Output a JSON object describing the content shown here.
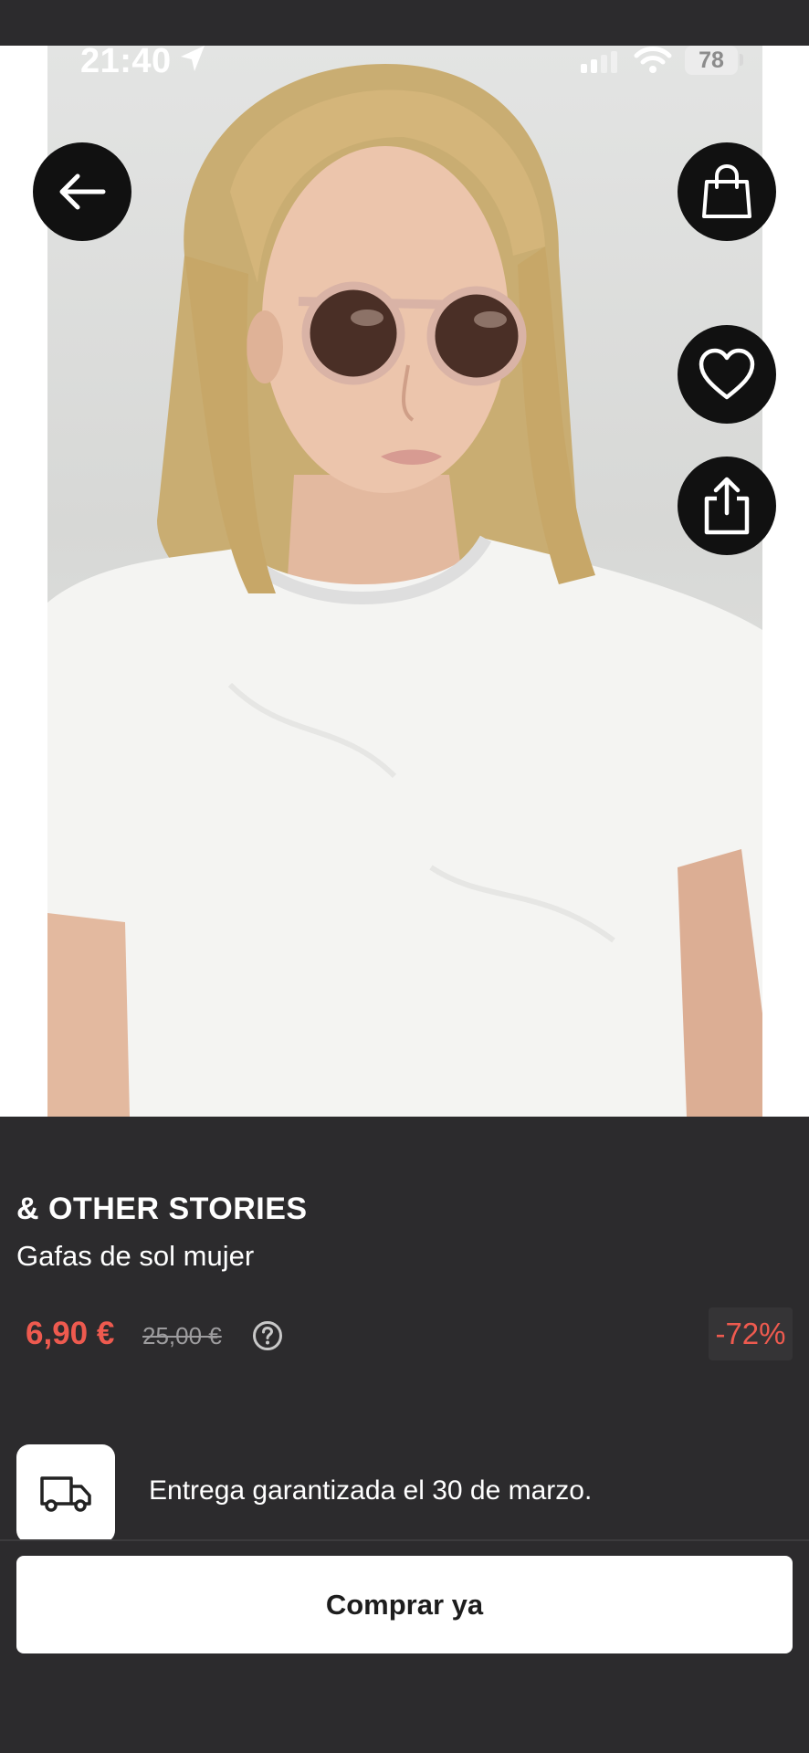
{
  "status_bar": {
    "time": "21:40",
    "battery": "78",
    "icons": [
      "location-arrow-icon",
      "signal-icon",
      "wifi-icon",
      "battery-icon"
    ]
  },
  "product_image": {
    "alt": "Woman with blond hair wearing round pink-framed sunglasses and a white t-shirt"
  },
  "actions": {
    "icons": [
      "back-arrow-icon",
      "shopping-bag-icon",
      "heart-icon",
      "share-icon"
    ]
  },
  "product": {
    "brand": "& OTHER STORIES",
    "name": "Gafas de sol mujer",
    "price_current": "6,90 €",
    "price_original": "25,00 €",
    "discount": "-72%"
  },
  "delivery": {
    "text": "Entrega garantizada el 30 de marzo.",
    "icon": "truck-icon"
  },
  "cta": {
    "buy_label": "Comprar ya"
  },
  "colors": {
    "background": "#2c2b2d",
    "accent_red": "#ee5a4f",
    "button_bg": "#ffffff"
  }
}
